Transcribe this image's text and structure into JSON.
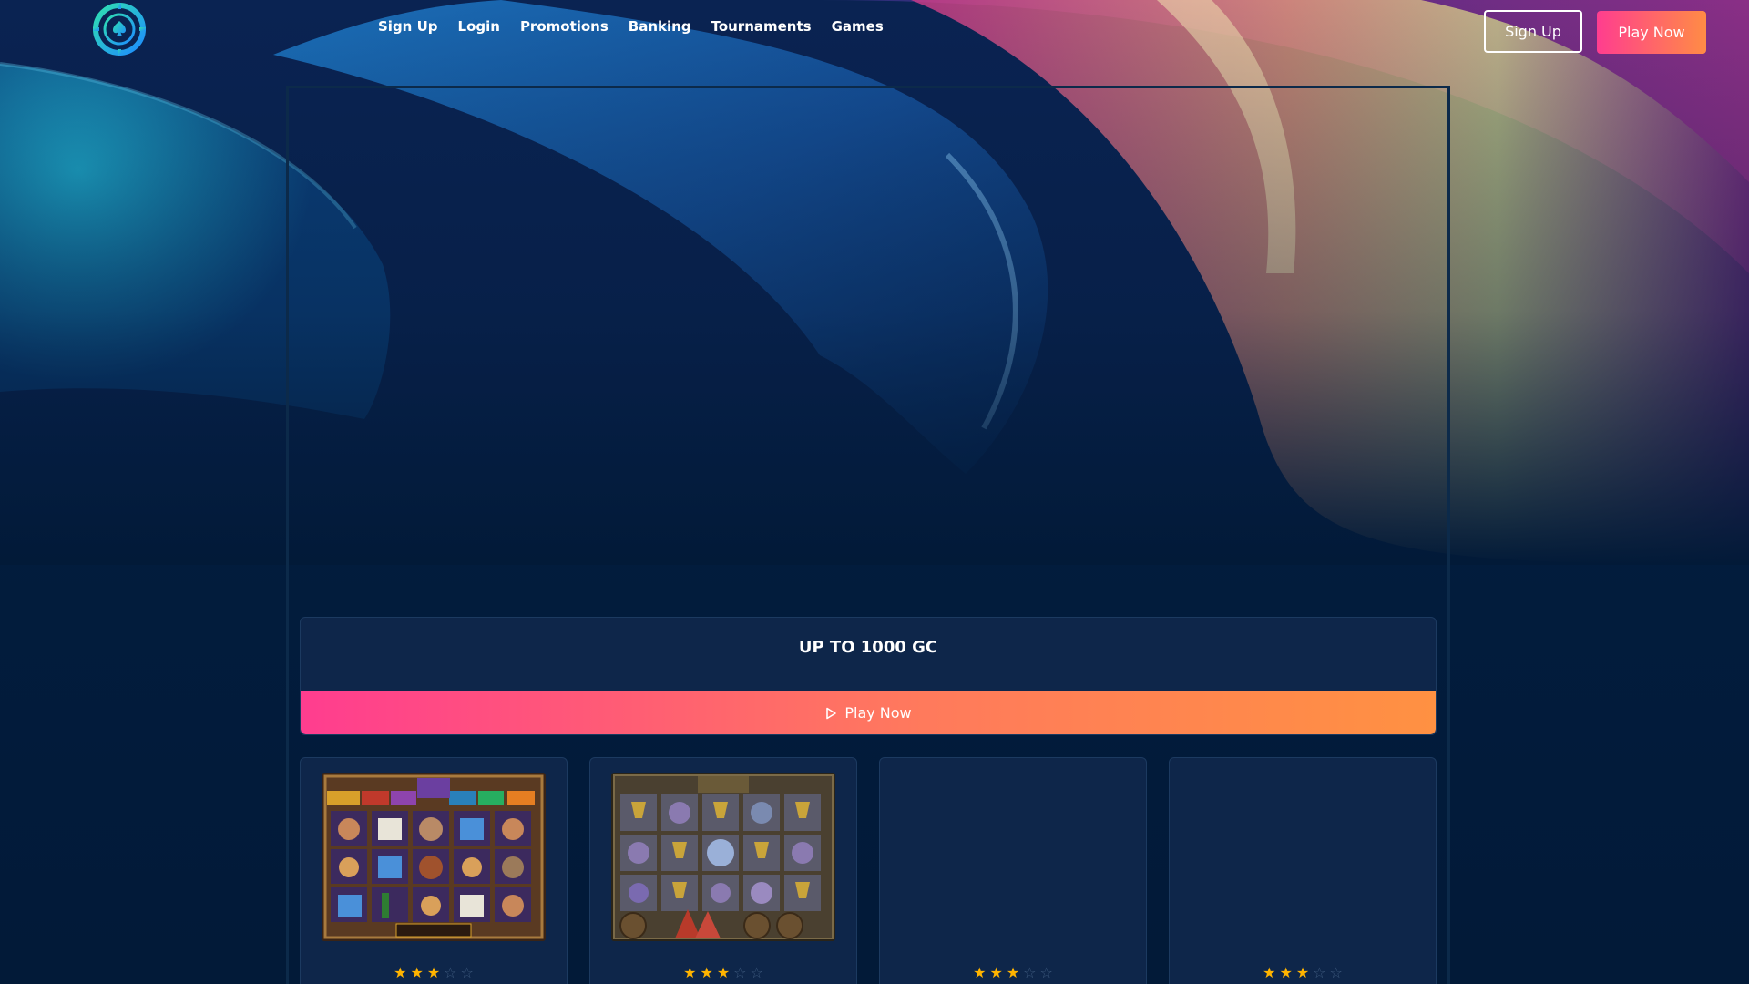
{
  "header": {
    "nav": [
      {
        "label": "Sign Up"
      },
      {
        "label": "Login"
      },
      {
        "label": "Promotions"
      },
      {
        "label": "Banking"
      },
      {
        "label": "Tournaments"
      },
      {
        "label": "Games"
      }
    ],
    "signup_label": "Sign Up",
    "playnow_label": "Play Now"
  },
  "promo": {
    "title": "UP TO 1000 GC",
    "play_label": "Play Now"
  },
  "games": [
    {
      "rating": 3,
      "max": 5
    },
    {
      "rating": 3,
      "max": 5
    },
    {
      "rating": 3,
      "max": 5
    },
    {
      "rating": 3,
      "max": 5
    }
  ],
  "colors": {
    "accent_start": "#ff3d8f",
    "accent_end": "#ff8c45",
    "star": "#ffb400",
    "bg": "#021a38"
  },
  "icons": {
    "logo": "poker-chip-spade-icon",
    "play": "play-icon",
    "star": "star-icon"
  }
}
